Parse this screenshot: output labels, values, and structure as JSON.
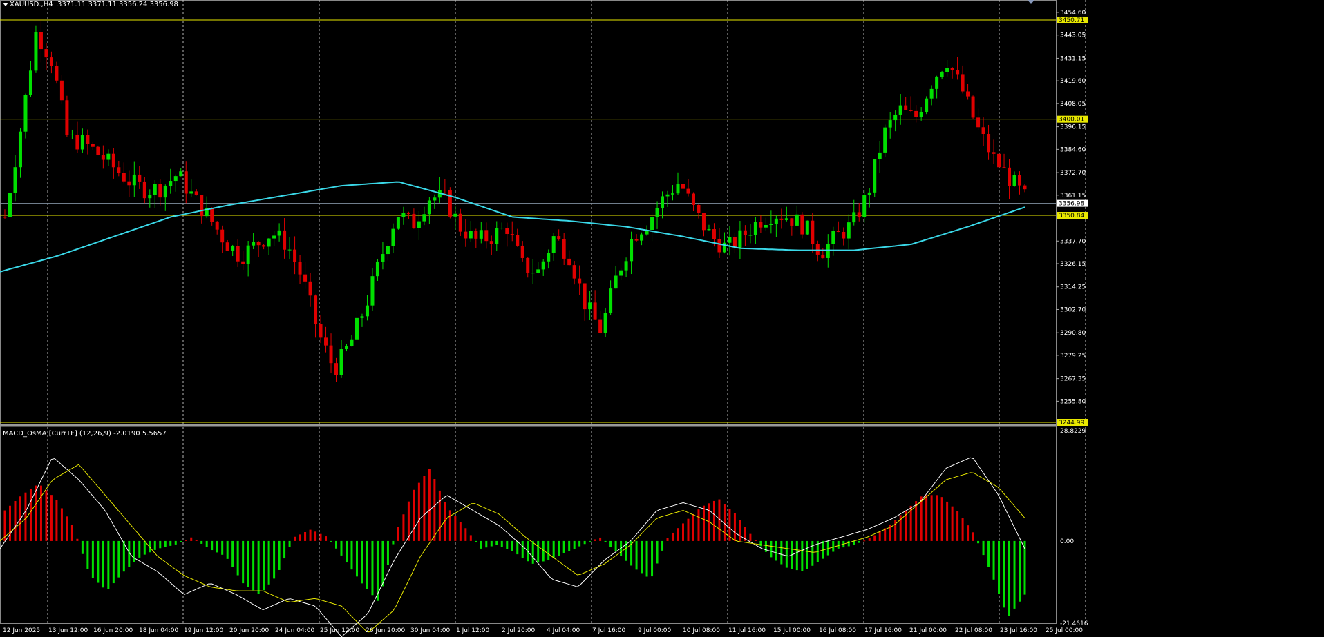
{
  "window": {
    "symbol_line": "XAUUSD.,H4  3371.11 3371.11 3356.24 3356.98",
    "indicator_line": "MACD_OsMA [CurrTF] (12,26,9) -2.0190 5.5657"
  },
  "colors": {
    "background": "#000000",
    "bull_candle": "#00e000",
    "bear_candle": "#e00000",
    "ma_line": "#3ad8e8",
    "level_line": "#e8e800",
    "grid": "#c8c8c8",
    "macd_line": "#ffffff",
    "signal_line": "#e8e800"
  },
  "chart_data": [
    {
      "type": "candlestick",
      "symbol": "XAUUSD.",
      "timeframe": "H4",
      "ylim": [
        3244.99,
        3456.0
      ],
      "y_ticks": [
        "3454.60",
        "3443.05",
        "3431.15",
        "3419.60",
        "3408.05",
        "3396.15",
        "3384.60",
        "3372.70",
        "3361.15",
        "3337.70",
        "3326.15",
        "3314.25",
        "3302.70",
        "3290.80",
        "3279.25",
        "3267.35",
        "3255.80"
      ],
      "x_ticks": [
        "12 Jun 2025",
        "13 Jun 12:00",
        "16 Jun 20:00",
        "18 Jun 04:00",
        "19 Jun 12:00",
        "20 Jun 20:00",
        "24 Jun 04:00",
        "25 Jun 12:00",
        "26 Jun 20:00",
        "30 Jun 04:00",
        "1 Jul 12:00",
        "2 Jul 20:00",
        "4 Jul 04:00",
        "7 Jul 16:00",
        "9 Jul 00:00",
        "10 Jul 08:00",
        "11 Jul 16:00",
        "15 Jul 00:00",
        "16 Jul 08:00",
        "17 Jul 16:00",
        "21 Jul 00:00",
        "22 Jul 08:00",
        "23 Jul 16:00",
        "25 Jul 00:00"
      ],
      "horizontal_levels": [
        {
          "value": 3450.71,
          "label": "3450.71"
        },
        {
          "value": 3400.01,
          "label": "3400.01"
        },
        {
          "value": 3350.84,
          "label": "3350.84"
        },
        {
          "value": 3244.99,
          "label": "3244.99"
        }
      ],
      "current_price": {
        "value": 3356.98,
        "label": "3356.98"
      },
      "ma_anchors": [
        3322,
        3330,
        3340,
        3350,
        3356,
        3361,
        3366,
        3368,
        3360,
        3350,
        3348,
        3345,
        3340,
        3334,
        3333,
        3333,
        3336,
        3345,
        3355
      ],
      "price_anchors": [
        3350,
        3395,
        3445,
        3430,
        3390,
        3388,
        3382,
        3375,
        3368,
        3364,
        3365,
        3372,
        3360,
        3350,
        3338,
        3330,
        3336,
        3342,
        3336,
        3318,
        3290,
        3272,
        3285,
        3305,
        3330,
        3352,
        3346,
        3360,
        3360,
        3345,
        3338,
        3340,
        3345,
        3325,
        3322,
        3340,
        3330,
        3305,
        3292,
        3320,
        3340,
        3348,
        3360,
        3368,
        3352,
        3340,
        3334,
        3340,
        3348,
        3352,
        3350,
        3345,
        3332,
        3340,
        3346,
        3362,
        3392,
        3405,
        3400,
        3418,
        3431,
        3415,
        3395,
        3380,
        3370,
        3360
      ]
    },
    {
      "type": "bar",
      "name": "MACD_OsMA [CurrTF] (12,26,9)",
      "ylim": [
        -21.4616,
        28.8229
      ],
      "y_ticks": [
        "28.8229",
        "0.00",
        "-21.4616"
      ],
      "histogram_anchors": [
        8,
        12,
        15,
        11,
        4,
        -9,
        -13,
        -8,
        -4,
        -2,
        -1,
        1,
        -2,
        -4,
        -11,
        -14,
        -9,
        1,
        3,
        1,
        -5,
        -11,
        -16,
        2,
        13,
        19,
        9,
        4,
        -2,
        -1,
        -3,
        -6,
        -5,
        -3,
        -1,
        1,
        -3,
        -7,
        -10,
        1,
        5,
        9,
        11,
        7,
        1,
        -4,
        -7,
        -8,
        -5,
        -2,
        -1,
        1,
        4,
        8,
        12,
        12,
        8,
        2,
        -8,
        -20,
        -14
      ],
      "macd_anchors": [
        -2,
        8,
        22,
        16,
        8,
        -4,
        -8,
        -14,
        -11,
        -14,
        -18,
        -15,
        -17,
        -25,
        -19,
        -5,
        6,
        12,
        8,
        4,
        -2,
        -10,
        -12,
        -5,
        0,
        8,
        10,
        8,
        2,
        -2,
        -4,
        -1,
        1,
        3,
        6,
        10,
        19,
        22,
        12,
        -2
      ],
      "signal_anchors": [
        0,
        6,
        16,
        20,
        12,
        4,
        -4,
        -9,
        -12,
        -13,
        -13,
        -16,
        -15,
        -17,
        -24,
        -18,
        -4,
        6,
        10,
        7,
        1,
        -4,
        -9,
        -6,
        -1,
        6,
        8,
        5,
        0,
        -1,
        -2,
        -3,
        -1,
        1,
        4,
        10,
        16,
        18,
        14,
        6
      ]
    }
  ]
}
